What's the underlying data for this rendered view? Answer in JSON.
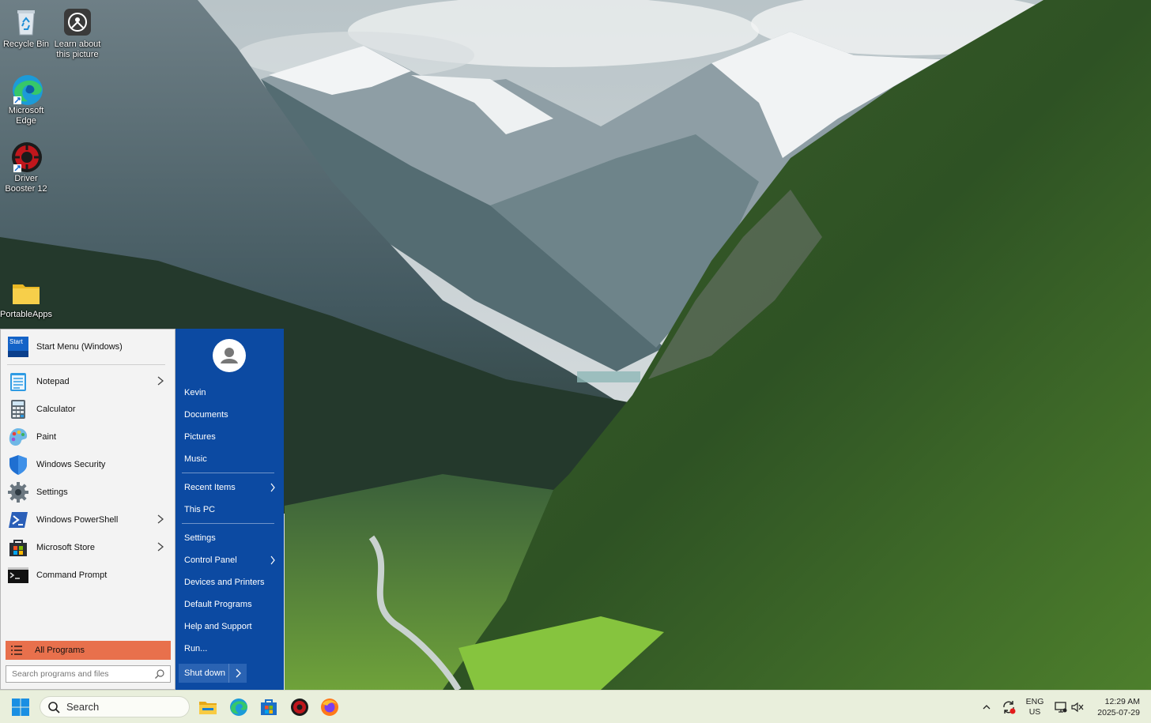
{
  "desktop": {
    "icons": [
      {
        "label": "Recycle Bin"
      },
      {
        "label": "Learn about this picture"
      },
      {
        "label": "Microsoft Edge"
      },
      {
        "label": "Driver Booster 12"
      },
      {
        "label": "PortableApps"
      }
    ]
  },
  "start_menu": {
    "header": {
      "label": "Start Menu (Windows)",
      "icon_text": "Start"
    },
    "pinned": [
      {
        "label": "Notepad",
        "has_submenu": true
      },
      {
        "label": "Calculator",
        "has_submenu": false
      },
      {
        "label": "Paint",
        "has_submenu": false
      },
      {
        "label": "Windows Security",
        "has_submenu": false
      },
      {
        "label": "Settings",
        "has_submenu": false
      },
      {
        "label": "Windows PowerShell",
        "has_submenu": true
      },
      {
        "label": "Microsoft Store",
        "has_submenu": true
      },
      {
        "label": "Command Prompt",
        "has_submenu": false
      }
    ],
    "all_programs": "All Programs",
    "search_placeholder": "Search programs and files",
    "right_items": {
      "user": "Kevin",
      "documents": "Documents",
      "pictures": "Pictures",
      "music": "Music",
      "recent_items": "Recent Items",
      "this_pc": "This PC",
      "settings": "Settings",
      "control_panel": "Control Panel",
      "devices_printers": "Devices and Printers",
      "default_programs": "Default Programs",
      "help_support": "Help and Support",
      "run": "Run..."
    },
    "shutdown": "Shut down",
    "colors": {
      "accent_blue": "#0c4aa2",
      "all_programs_highlight": "#e8704c"
    }
  },
  "taskbar": {
    "search_label": "Search",
    "apps": [
      "File Explorer",
      "Microsoft Edge",
      "Microsoft Store",
      "Driver Booster",
      "Firefox"
    ],
    "tray": {
      "lang_line1": "ENG",
      "lang_line2": "US",
      "time": "12:29 AM",
      "date": "2025-07-29"
    }
  }
}
